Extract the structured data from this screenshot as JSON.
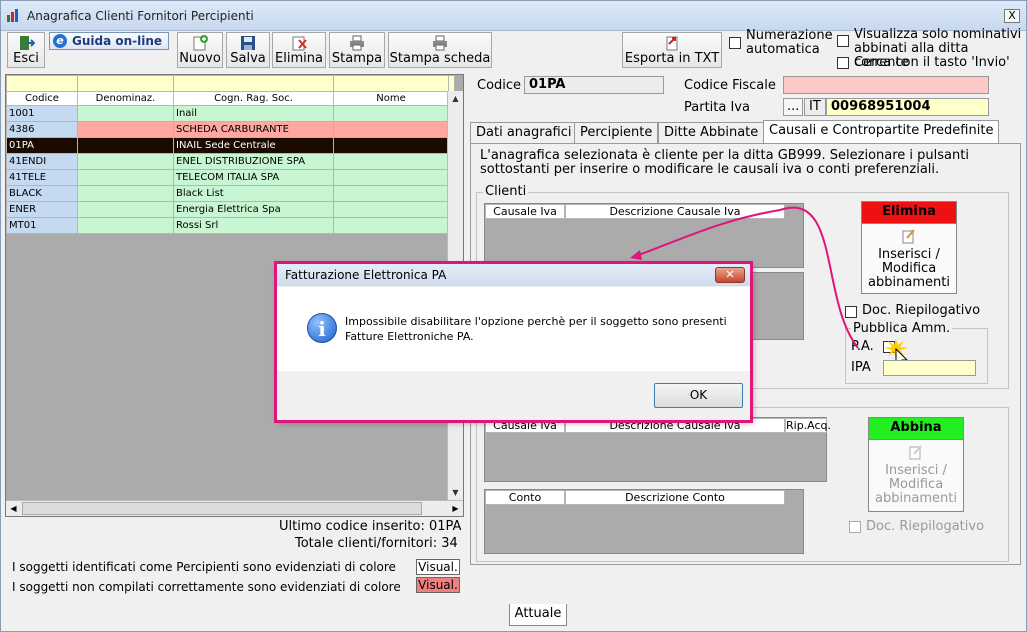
{
  "window": {
    "title": "Anagrafica Clienti Fornitori Percipienti",
    "close": "X"
  },
  "toolbar": {
    "esci": "Esci",
    "guida": "Guida on-line",
    "nuovo": "Nuovo",
    "salva": "Salva",
    "elimina": "Elimina",
    "stampa": "Stampa",
    "stampa_scheda": "Stampa scheda",
    "esporta": "Esporta in TXT"
  },
  "options": {
    "numerazione": "Numerazione automatica",
    "visualizza": "Visualizza solo nominativi abbinati alla ditta corrente",
    "cerca": "Cerca con il tasto 'Invio'"
  },
  "grid": {
    "columns": [
      "Codice",
      "Denominaz.",
      "Cogn. Rag. Soc.",
      "Nome"
    ],
    "rows": [
      {
        "code": "1001",
        "rag": "Inail",
        "color": "#c8f5d2"
      },
      {
        "code": "4386",
        "rag": "SCHEDA CARBURANTE",
        "color": "#ffa8a0"
      },
      {
        "code": "01PA",
        "rag": "INAIL Sede Centrale",
        "color": "#1a0a00"
      },
      {
        "code": "41ENDI",
        "rag": "ENEL DISTRIBUZIONE SPA",
        "color": "#c8f5d2"
      },
      {
        "code": "41TELE",
        "rag": "TELECOM ITALIA SPA",
        "color": "#c8f5d2"
      },
      {
        "code": "BLACK",
        "rag": "Black List",
        "color": "#c8f5d2"
      },
      {
        "code": "ENER",
        "rag": "Energia Elettrica Spa",
        "color": "#c8f5d2"
      },
      {
        "code": "MT01",
        "rag": "Rossi Srl",
        "color": "#c8f5d2"
      }
    ]
  },
  "footer": {
    "ultimo": "Ultimo codice inserito: 01PA",
    "totale": "Totale clienti/fornitori: 34",
    "legend1": "I soggetti identificati come Percipienti sono evidenziati di colore",
    "legend2": "I soggetti non compilati correttamente sono evidenziati di colore",
    "visual": "Visual."
  },
  "detail": {
    "codice_label": "Codice",
    "codice_value": "01PA",
    "cf_label": "Codice Fiscale",
    "piva_label": "Partita Iva",
    "piva_btn": "...",
    "piva_prefix": "IT",
    "piva_value": "00968951004"
  },
  "tabs": [
    "Dati anagrafici",
    "Percipiente",
    "Ditte Abbinate",
    "Causali e Contropartite Predefinite"
  ],
  "causali": {
    "intro": "L'anagrafica selezionata è cliente per la ditta GB999. Selezionare i pulsanti sottostanti per inserire o modificare le causali iva o conti preferenziali.",
    "clienti": "Clienti",
    "causale_iva": "Causale Iva",
    "descr_causale": "Descrizione Causale Iva",
    "rip_acq": "Rip.Acq.",
    "conto": "Conto",
    "descr_conto": "Descrizione Conto",
    "elimina": "Elimina",
    "abbina": "Abbina",
    "inserisci": "Inserisci / Modifica abbinamenti",
    "doc_riep": "Doc. Riepilogativo",
    "pubblica": "Pubblica Amm.",
    "pa": "P.A.",
    "ipa": "IPA"
  },
  "dialog": {
    "title": "Fatturazione Elettronica PA",
    "message": "Impossibile disabilitare l'opzione perchè per il soggetto sono presenti Fatture Elettroniche PA.",
    "ok": "OK"
  },
  "bottom_tab": "Attuale"
}
